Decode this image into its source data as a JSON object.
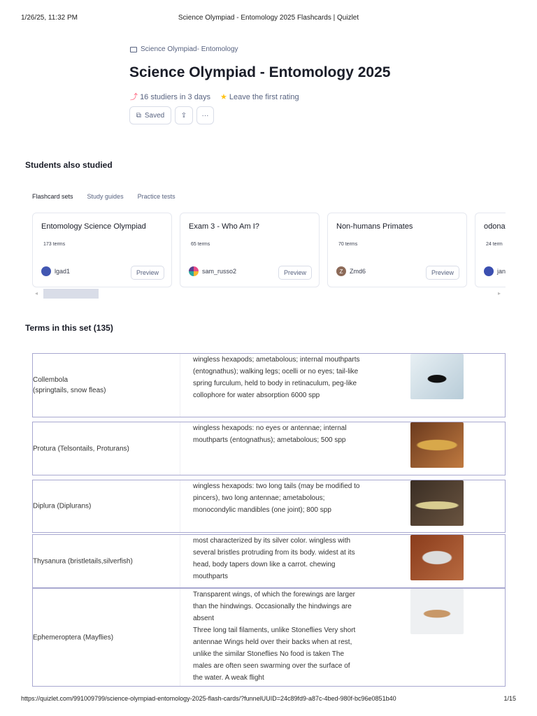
{
  "print_header": {
    "datetime": "1/26/25, 11:32 PM",
    "title": "Science Olympiad - Entomology 2025 Flashcards | Quizlet"
  },
  "breadcrumb": "Science Olympiad- Entomology",
  "title": "Science Olympiad - Entomology 2025",
  "stats": {
    "studiers": "16 studiers in 3 days",
    "rating": "Leave the first rating"
  },
  "actions": {
    "saved": "Saved"
  },
  "also_studied": {
    "heading": "Students also studied",
    "tabs": [
      "Flashcard sets",
      "Study guides",
      "Practice tests"
    ],
    "cards": [
      {
        "title": "Entomology Science Olympiad",
        "terms": "173 terms",
        "user": "lgad1",
        "preview": "Preview"
      },
      {
        "title": "Exam 3 - Who Am I?",
        "terms": "65 terms",
        "user": "sam_russo2",
        "preview": "Preview"
      },
      {
        "title": "Non-humans Primates",
        "terms": "70 terms",
        "user": "Zmd6",
        "preview": "Preview",
        "avatar_letter": "Z"
      },
      {
        "title": "odonat",
        "terms": "24 term",
        "user": "jan",
        "preview": "Preview"
      }
    ]
  },
  "terms_heading": "Terms in this set (135)",
  "terms": [
    {
      "term": "Collembola\n(springtails, snow fleas)",
      "definition": "wingless hexapods; ametabolous; internal mouthparts (entognathus); walking legs; ocelli or no eyes; tail-like spring furculum, held to body in retinaculum, peg-like collophore for water absorption 6000 spp"
    },
    {
      "term": "Protura (Telsontails, Proturans)",
      "definition": "wingless hexapods: no eyes or antennae; internal mouthparts (entognathus); ametabolous; 500 spp"
    },
    {
      "term": "Diplura (Diplurans)",
      "definition": "wingless hexapods: two long tails (may be modified to pincers), two long antennae; ametabolous; monocondylic mandibles (one joint); 800 spp"
    },
    {
      "term": "Thysanura (bristletails,silverfish)",
      "definition": "most characterized by its silver color. wingless with several bristles protruding from its body. widest at its head, body tapers down like a carrot. chewing mouthparts"
    },
    {
      "term": "Ephemeroptera (Mayflies)",
      "definition": "Transparent wings, of which the forewings are larger than the hindwings. Occasionally the hindwings are absent\nThree long tail filaments, unlike Stoneflies Very short antennae Wings held over their backs when at rest, unlike the similar Stoneflies No food is taken The males are often seen swarming over the surface of the water. A weak flight"
    }
  ],
  "print_footer": {
    "url": "https://quizlet.com/991009799/science-olympiad-entomology-2025-flash-cards/?funnelUUID=24c89fd9-a87c-4bed-980f-bc96e0851b40",
    "page": "1/15"
  }
}
